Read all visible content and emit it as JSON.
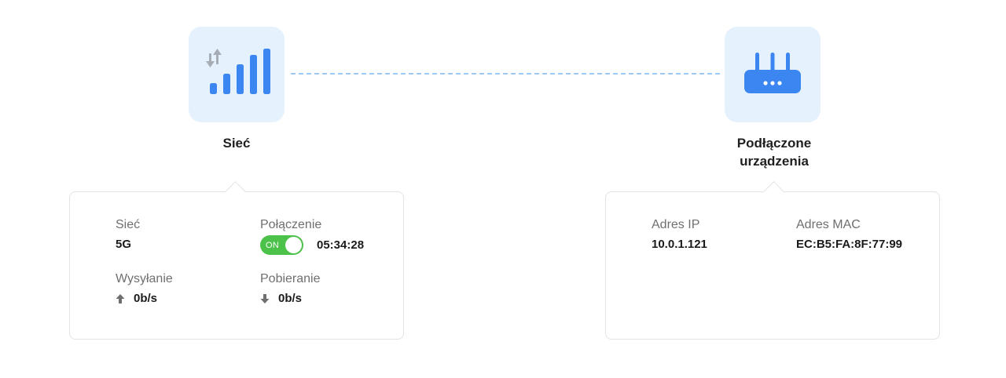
{
  "nodes": {
    "network": {
      "title": "Sieć",
      "icon": "cellular-signal-icon"
    },
    "devices": {
      "title": "Podłączone urządzenia",
      "icon": "router-icon"
    }
  },
  "network_card": {
    "network_label": "Sieć",
    "network_value": "5G",
    "connection_label": "Połączenie",
    "connection_toggle": "ON",
    "connection_time": "05:34:28",
    "upload_label": "Wysyłanie",
    "upload_value": "0b/s",
    "download_label": "Pobieranie",
    "download_value": "0b/s"
  },
  "device_card": {
    "ip_label": "Adres IP",
    "ip_value": "10.0.1.121",
    "mac_label": "Adres MAC",
    "mac_value": "EC:B5:FA:8F:77:99"
  },
  "colors": {
    "accent_blue": "#3b86f0",
    "tile_bg": "#e6f1fe",
    "toggle_on": "#4cc24a",
    "dashed_line": "#9ccaf3"
  }
}
